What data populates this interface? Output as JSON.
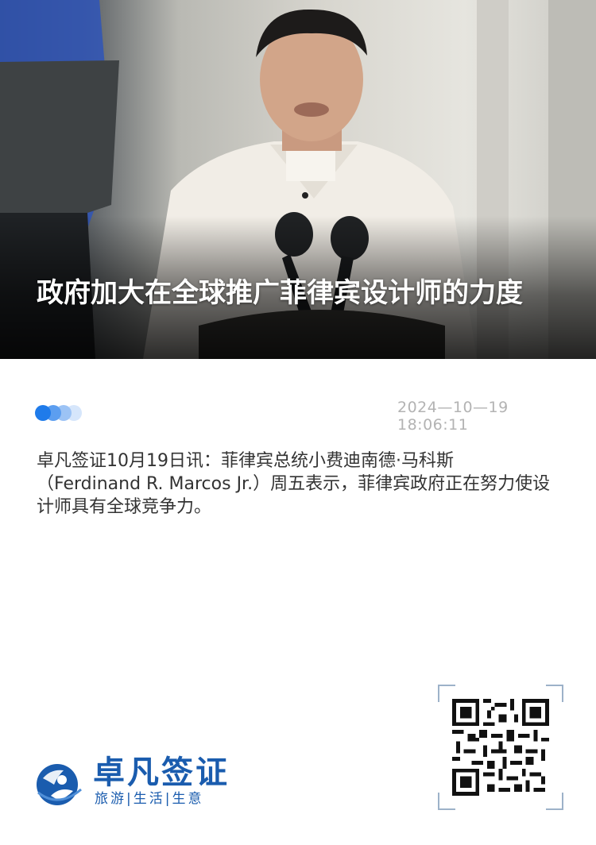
{
  "hero": {
    "title": "政府加大在全球推广菲律宾设计师的力度",
    "image_icon": "photo-of-speaker-at-podium"
  },
  "meta": {
    "date": "2024—10—19 18:06:11",
    "indicator_icon": "dots-indicator-icon"
  },
  "article": {
    "body": "卓凡签证10月19日讯：菲律宾总统小费迪南德·马科斯（Ferdinand R. Marcos Jr.）周五表示，菲律宾政府正在努力使设计师具有全球竞争力。"
  },
  "footer": {
    "brand_name": "卓凡签证",
    "slogan": "旅游|生活|生意",
    "logo_icon": "globe-person-logo-icon",
    "qr_icon": "qr-code-icon"
  },
  "colors": {
    "accent": "#1f7bea",
    "brand": "#1a5cae",
    "date": "#b3b3b3",
    "text": "#333333"
  }
}
